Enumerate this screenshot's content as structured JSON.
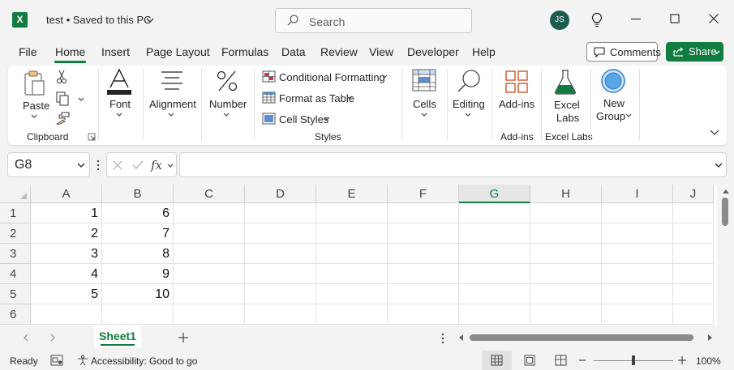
{
  "titlebar": {
    "app_logo": "X",
    "doc_title": "test • Saved to this PC",
    "search_placeholder": "Search",
    "user_initials": "JS"
  },
  "tabs": [
    "File",
    "Home",
    "Insert",
    "Page Layout",
    "Formulas",
    "Data",
    "Review",
    "View",
    "Developer",
    "Help"
  ],
  "active_tab": "Home",
  "header_buttons": {
    "comments": "Comments",
    "share": "Share"
  },
  "ribbon": {
    "clipboard": {
      "paste": "Paste",
      "group": "Clipboard"
    },
    "font": "Font",
    "alignment": "Alignment",
    "number": "Number",
    "styles": {
      "conditional": "Conditional Formatting",
      "format_table": "Format as Table",
      "cell_styles": "Cell Styles",
      "group": "Styles"
    },
    "cells": "Cells",
    "editing": "Editing",
    "addins": {
      "button": "Add-ins",
      "group": "Add-ins"
    },
    "excel_labs": {
      "line1": "Excel",
      "line2": "Labs",
      "group": "Excel Labs"
    },
    "new_group": {
      "line1": "New",
      "line2": "Group"
    }
  },
  "formula_bar": {
    "name_box": "G8",
    "fx": "fx",
    "formula": ""
  },
  "grid": {
    "columns": [
      "A",
      "B",
      "C",
      "D",
      "E",
      "F",
      "G",
      "H",
      "I",
      "J"
    ],
    "selected_column": "G",
    "rows": [
      "1",
      "2",
      "3",
      "4",
      "5",
      "6"
    ],
    "cells": [
      [
        "1",
        "6"
      ],
      [
        "2",
        "7"
      ],
      [
        "3",
        "8"
      ],
      [
        "4",
        "9"
      ],
      [
        "5",
        "10"
      ],
      [
        "",
        ""
      ]
    ]
  },
  "sheets": [
    "Sheet1"
  ],
  "statusbar": {
    "ready": "Ready",
    "accessibility": "Accessibility: Good to go",
    "zoom": "100%"
  },
  "colors": {
    "accent": "#107c41",
    "avatar": "#1d5c4f"
  }
}
